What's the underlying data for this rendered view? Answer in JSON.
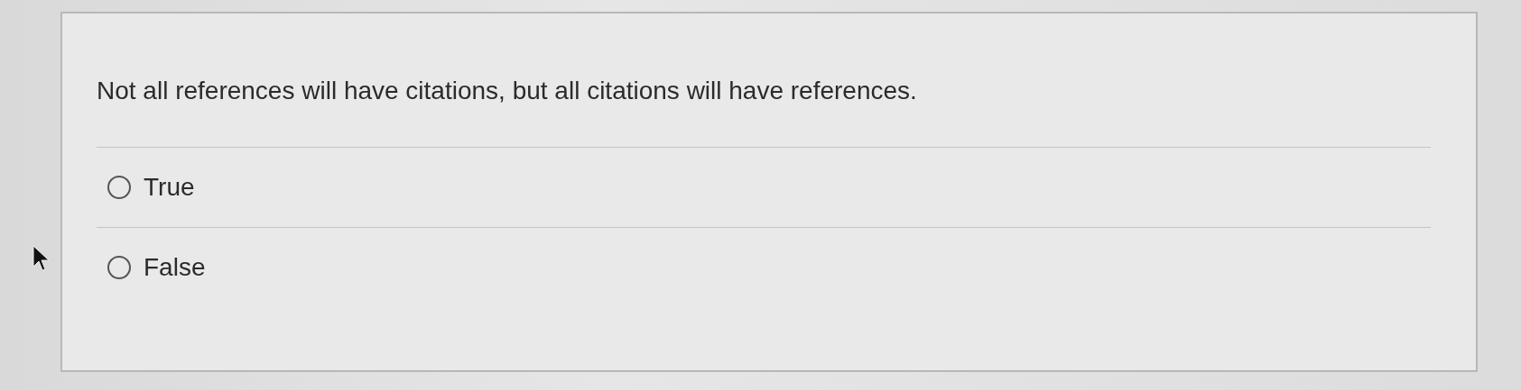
{
  "question": {
    "text": "Not all references will have citations, but all citations will have references.",
    "options": [
      {
        "label": "True",
        "selected": false
      },
      {
        "label": "False",
        "selected": false
      }
    ]
  }
}
